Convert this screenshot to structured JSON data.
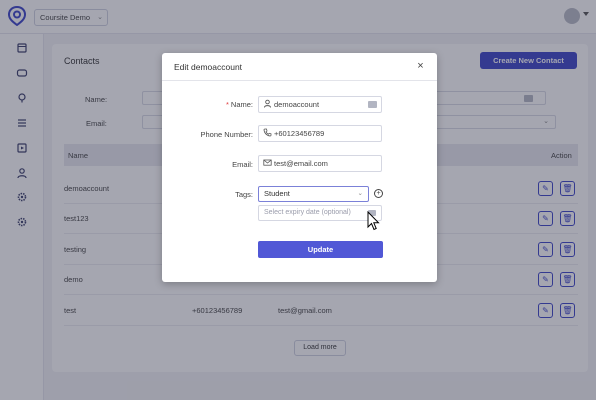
{
  "header": {
    "workspace": "Coursite Demo"
  },
  "contacts": {
    "title": "Contacts",
    "create_button": "Create New Contact",
    "filters": {
      "name_label": "Name:",
      "email_label": "Email:"
    },
    "columns": {
      "name": "Name",
      "action": "Action"
    },
    "rows": [
      {
        "name": "demoaccount",
        "phone": "",
        "email": ""
      },
      {
        "name": "test123",
        "phone": "",
        "email": ""
      },
      {
        "name": "testing",
        "phone": "",
        "email": ""
      },
      {
        "name": "demo",
        "phone": "",
        "email": ""
      },
      {
        "name": "test",
        "phone": "+60123456789",
        "email": "test@gmail.com"
      }
    ],
    "load_more": "Load more"
  },
  "modal": {
    "title": "Edit demoaccount",
    "fields": {
      "name_label": "Name:",
      "name_required_mark": "*",
      "name_value": "demoaccount",
      "phone_label": "Phone Number:",
      "phone_value": "+60123456789",
      "email_label": "Email:",
      "email_value": "test@email.com",
      "tags_label": "Tags:",
      "tags_value": "Student",
      "expiry_placeholder": "Select expiry date (optional)"
    },
    "update_button": "Update"
  },
  "colors": {
    "primary": "#3d45c9",
    "button": "#5158d6",
    "required": "#e0393c",
    "overlay": "rgba(40,44,66,0.42)"
  }
}
